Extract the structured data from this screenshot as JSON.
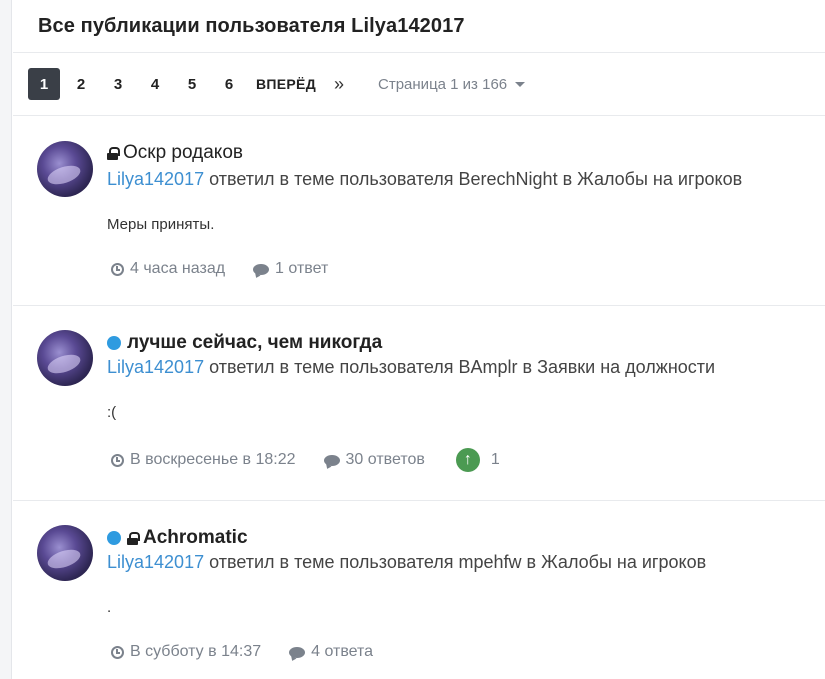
{
  "page_title": "Все публикации пользователя Lilya142017",
  "pagination": {
    "pages": [
      "1",
      "2",
      "3",
      "4",
      "5",
      "6"
    ],
    "active_page": "1",
    "next_label": "ВПЕРЁД",
    "last_label": "»",
    "page_info": "Страница 1 из 166"
  },
  "posts": [
    {
      "title": "Оскр родаков",
      "locked": true,
      "unread": false,
      "user": "Lilya142017",
      "action": " ответил в теме пользователя BerechNight в Жалобы на игроков",
      "content": "Меры приняты.",
      "time": "4 часа назад",
      "replies": "1 ответ"
    },
    {
      "title": "лучше сейчас, чем никогда",
      "locked": false,
      "unread": true,
      "user": "Lilya142017",
      "action": " ответил в теме пользователя BAmplr в Заявки на должности",
      "content": ":(",
      "time": "В воскресенье в 18:22",
      "replies": "30 ответов",
      "reputation": "1"
    },
    {
      "title": "Achromatic",
      "locked": true,
      "unread": true,
      "user": "Lilya142017",
      "action": " ответил в теме пользователя mpehfw в Жалобы на игроков",
      "content": ".",
      "time": "В субботу в 14:37",
      "replies": "4 ответа"
    }
  ],
  "colors": {
    "accent_link": "#3d8fd1",
    "unread_dot": "#2f9be0",
    "active_page_bg": "#3a3f47",
    "upvote": "#4b9a52"
  },
  "icons": [
    "lock-icon",
    "unread-dot-icon",
    "clock-icon",
    "comment-icon",
    "upvote-icon",
    "double-chevron-right-icon",
    "caret-down-icon"
  ]
}
